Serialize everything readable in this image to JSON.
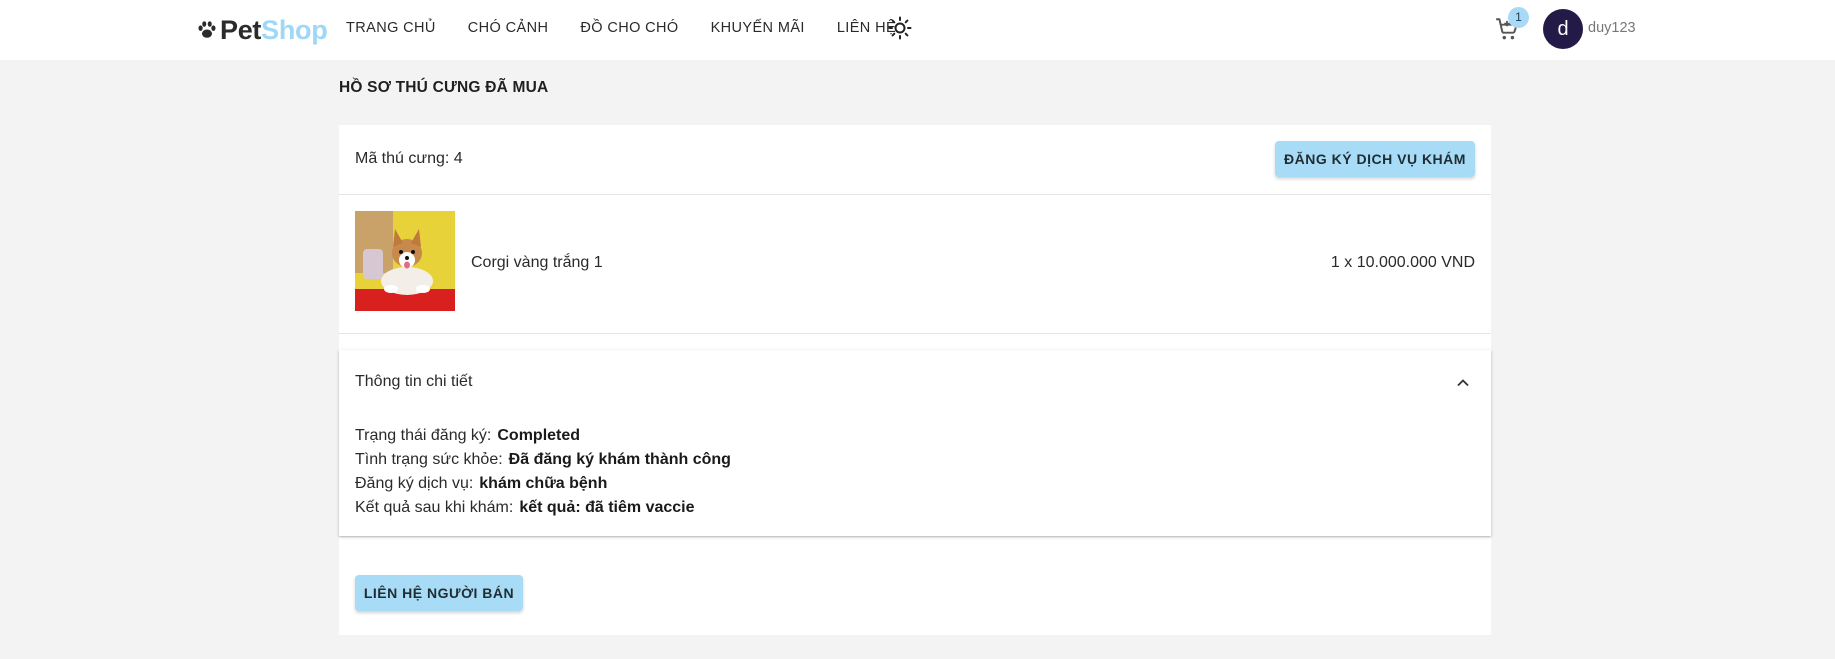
{
  "header": {
    "logo": {
      "part1": "Pet",
      "part2": "Shop",
      "icon": "paw-icon"
    },
    "nav": [
      "TRANG CHỦ",
      "CHÓ CẢNH",
      "ĐỒ CHO CHÓ",
      "KHUYẾN MÃI",
      "LIÊN HỆ"
    ],
    "theme_icon": "sun-icon",
    "cart": {
      "icon": "cart-icon",
      "count": "1"
    },
    "user": {
      "avatar_letter": "d",
      "username": "duy123"
    }
  },
  "page": {
    "title": "HỒ SƠ THÚ CƯNG ĐÃ MUA",
    "pet_id": "Mã thú cưng: 4",
    "register_button": "ĐĂNG KÝ DỊCH VỤ KHÁM",
    "product": {
      "name": "Corgi vàng trắng 1",
      "price": "1 x 10.000.000 VND"
    },
    "details": {
      "title": "Thông tin chi tiết",
      "rows": [
        {
          "label": "Trạng thái đăng ký:",
          "value": "Completed"
        },
        {
          "label": "Tình trạng sức khỏe:",
          "value": "Đã đăng ký khám thành công"
        },
        {
          "label": "Đăng ký dịch vụ:",
          "value": "khám chữa bệnh"
        },
        {
          "label": "Kết quả sau khi khám:",
          "value": "kết quả: đã tiêm vaccie"
        }
      ]
    },
    "contact_button": "LIÊN HỆ NGƯỜI BÁN"
  },
  "colors": {
    "accent_button": "#a8dcf6",
    "logo_shop": "#9fd7f6",
    "avatar_bg": "#231a47",
    "page_bg": "#f3f3f3"
  }
}
